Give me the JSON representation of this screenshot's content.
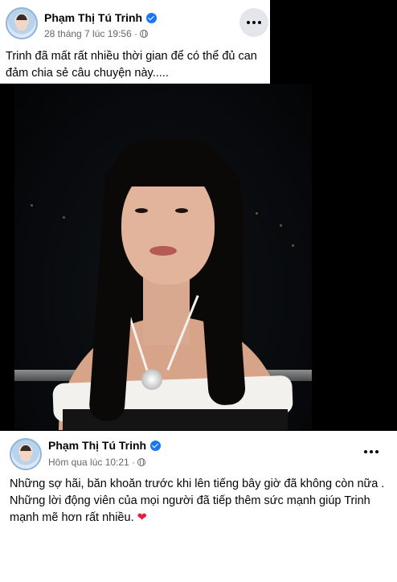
{
  "post_top": {
    "author": "Phạm Thị Tú Trinh",
    "timestamp": "28 tháng 7 lúc 19:56 ·",
    "text": "Trinh đã mất rất nhiều thời gian để có thể đủ can đảm chia sẻ câu chuyện này....."
  },
  "post_bottom": {
    "author": "Phạm Thị Tú Trinh",
    "timestamp": "Hôm qua lúc 10:21 ·",
    "text": "Những sợ hãi, băn khoăn trước khi lên tiếng bây giờ đã không còn nữa . Những lời động viên của mọi người đã tiếp thêm sức mạnh giúp Trinh mạnh mẽ hơn rất nhiều.",
    "emoji": "❤"
  },
  "icons": {
    "verified": "verified-badge-icon",
    "audience": "globe-icon",
    "more": "more-options-icon"
  },
  "colors": {
    "verified": "#1877f2",
    "heart": "#e41e3f",
    "secondary_text": "#65676b"
  }
}
